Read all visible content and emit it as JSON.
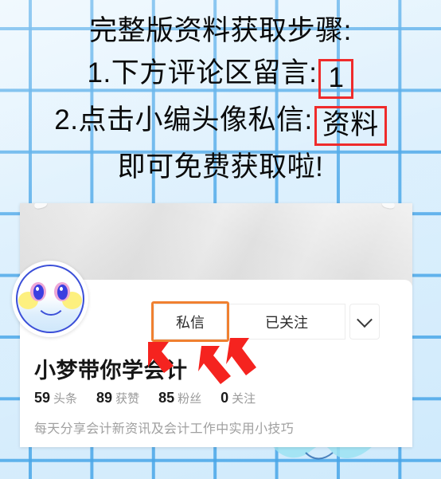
{
  "background": {
    "grid_line_color": "#46a5e8",
    "base_color": "#ddf0fd"
  },
  "headline": {
    "lines": [
      {
        "text": "完整版资料获取步骤:",
        "boxed": ""
      },
      {
        "text": "1.下方评论区留言:",
        "boxed": "1"
      },
      {
        "text": "2.点击小编头像私信:",
        "boxed": "资料"
      },
      {
        "text": "即可免费获取啦!",
        "boxed": ""
      }
    ],
    "box_color": "#ef2b2b"
  },
  "profile": {
    "username": "小梦带你学会计",
    "bio": "每天分享会计新资讯及会计工作中实用小技巧",
    "avatar_icon": "smiley-face-avatar",
    "stats": [
      {
        "value": "59",
        "label": "头条"
      },
      {
        "value": "89",
        "label": "获赞"
      },
      {
        "value": "85",
        "label": "粉丝"
      },
      {
        "value": "0",
        "label": "关注"
      }
    ],
    "actions": {
      "message_label": "私信",
      "follow_label": "已关注",
      "more_icon": "chevron-down-icon",
      "highlight_color": "#f08030"
    }
  },
  "annotations": {
    "arrow_color": "#f5231f",
    "arrow_count": 3,
    "arrow_target": "私信"
  }
}
